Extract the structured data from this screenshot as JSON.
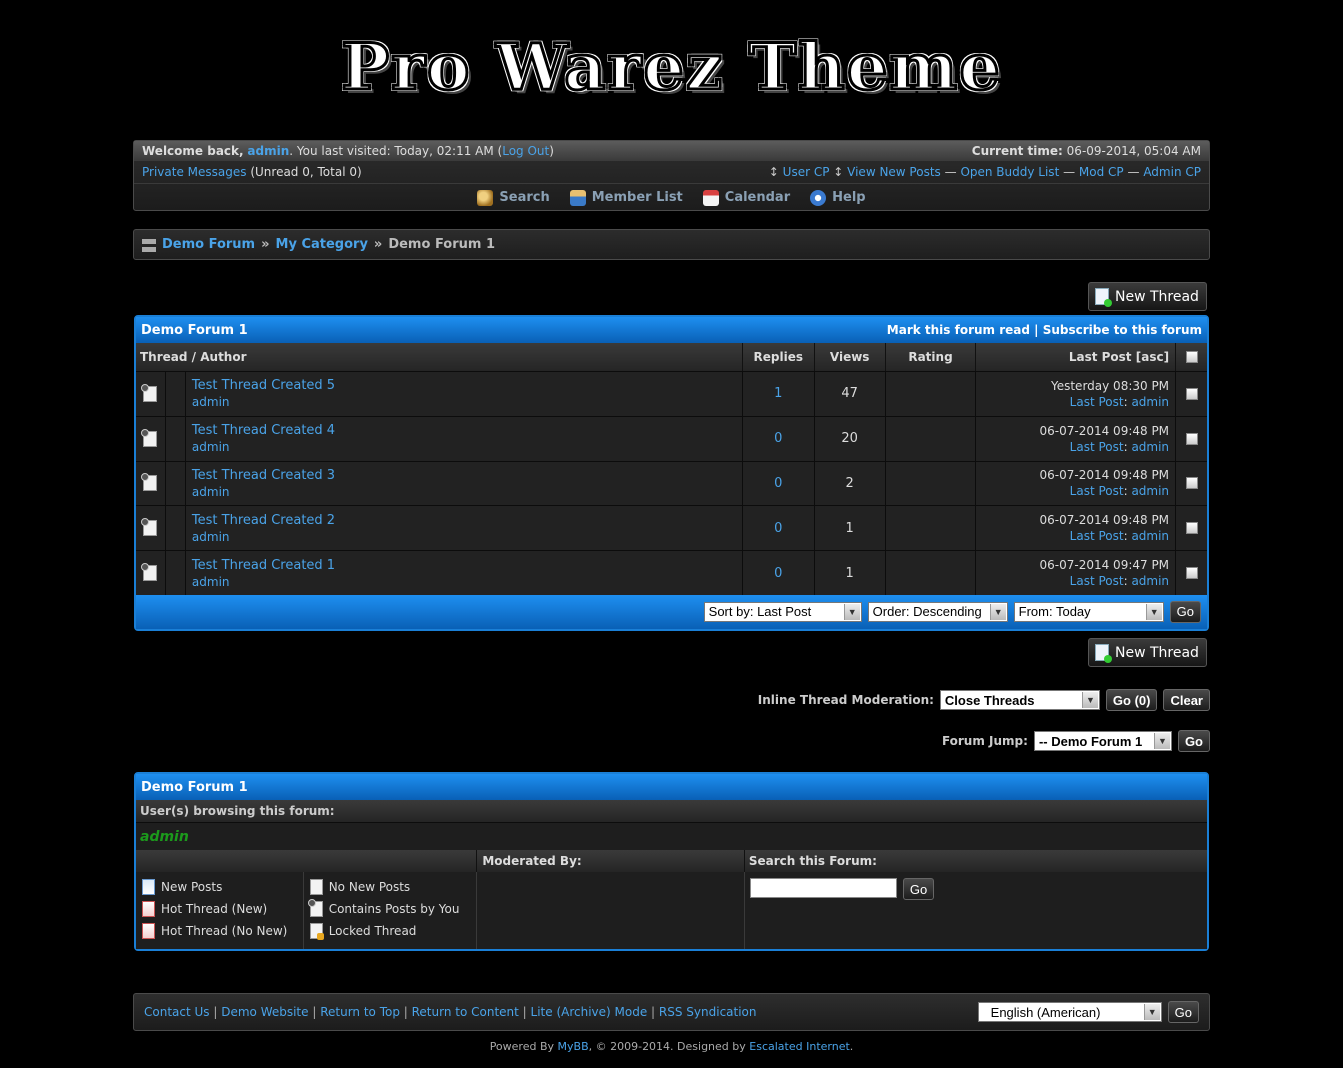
{
  "logo": {
    "text": "Pro Warez Theme"
  },
  "header": {
    "welcome_prefix": "Welcome back,",
    "username": "admin",
    "last_visited": ". You last visited: Today, 02:11 AM (",
    "logout": "Log Out",
    "close_paren": ")",
    "current_time_label": "Current time:",
    "current_time": "06-09-2014, 05:04 AM",
    "private_messages": "Private Messages",
    "pm_counts": "(Unread 0, Total 0)",
    "user_links": [
      "User CP",
      "View New Posts",
      "Open Buddy List",
      "Mod CP",
      "Admin CP"
    ],
    "nav": [
      {
        "label": "Search",
        "icon": "search-icon",
        "color": "#d8a850"
      },
      {
        "label": "Member List",
        "icon": "members-icon",
        "color": "#5a9ad8"
      },
      {
        "label": "Calendar",
        "icon": "calendar-icon",
        "color": "#d84040"
      },
      {
        "label": "Help",
        "icon": "help-icon",
        "color": "#4a8ad8"
      }
    ]
  },
  "breadcrumb": {
    "items": [
      "Demo Forum",
      "My Category"
    ],
    "current": "Demo Forum 1",
    "sep": "»"
  },
  "new_thread_label": "New Thread",
  "forum": {
    "title": "Demo Forum 1",
    "mark_read": "Mark this forum read",
    "subscribe": "Subscribe to this forum",
    "columns": {
      "thread": "Thread",
      "author": "Author",
      "replies": "Replies",
      "views": "Views",
      "rating": "Rating",
      "last_post": "Last Post",
      "asc": "asc"
    },
    "threads": [
      {
        "title": "Test Thread Created 5",
        "author": "admin",
        "replies": "1",
        "views": "47",
        "date": "Yesterday 08:30 PM",
        "last_by": "admin"
      },
      {
        "title": "Test Thread Created 4",
        "author": "admin",
        "replies": "0",
        "views": "20",
        "date": "06-07-2014 09:48 PM",
        "last_by": "admin"
      },
      {
        "title": "Test Thread Created 3",
        "author": "admin",
        "replies": "0",
        "views": "2",
        "date": "06-07-2014 09:48 PM",
        "last_by": "admin"
      },
      {
        "title": "Test Thread Created 2",
        "author": "admin",
        "replies": "0",
        "views": "1",
        "date": "06-07-2014 09:48 PM",
        "last_by": "admin"
      },
      {
        "title": "Test Thread Created 1",
        "author": "admin",
        "replies": "0",
        "views": "1",
        "date": "06-07-2014 09:47 PM",
        "last_by": "admin"
      }
    ],
    "last_post_link": "Last Post",
    "sort_by": "Sort by: Last Post",
    "order": "Order: Descending",
    "from": "From: Today",
    "go": "Go"
  },
  "moderation": {
    "label": "Inline Thread Moderation:",
    "option": "Close Threads",
    "go": "Go (0)",
    "clear": "Clear"
  },
  "forum_jump": {
    "label": "Forum Jump:",
    "option": "-- Demo Forum 1",
    "go": "Go"
  },
  "info": {
    "title": "Demo Forum 1",
    "browsing_label": "User(s) browsing this forum:",
    "browsing_user": "admin",
    "moderated_by": "Moderated By:",
    "search_forum": "Search this Forum:",
    "search_go": "Go",
    "legend_left": [
      {
        "label": "New Posts",
        "icon": "new-posts-icon"
      },
      {
        "label": "Hot Thread (New)",
        "icon": "hot-new-icon"
      },
      {
        "label": "Hot Thread (No New)",
        "icon": "hot-nonew-icon"
      }
    ],
    "legend_right": [
      {
        "label": "No New Posts",
        "icon": "no-new-posts-icon"
      },
      {
        "label": "Contains Posts by You",
        "icon": "your-posts-icon"
      },
      {
        "label": "Locked Thread",
        "icon": "locked-icon"
      }
    ]
  },
  "footer": {
    "links": [
      "Contact Us",
      "Demo Website",
      "Return to Top",
      "Return to Content",
      "Lite (Archive) Mode",
      "RSS Syndication"
    ],
    "language": "English (American)",
    "go": "Go",
    "powered_by": "Powered By",
    "mybb": "MyBB",
    "copy_mid": ", © 2009-2014. Designed by",
    "designer": "Escalated Internet",
    "copy_end": "."
  }
}
